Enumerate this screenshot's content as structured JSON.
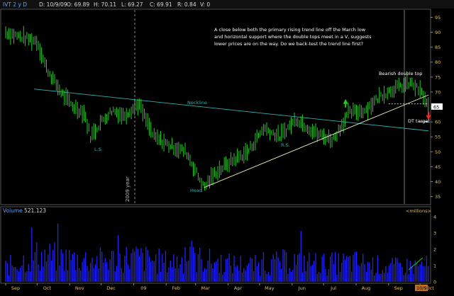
{
  "header": {
    "symbol": "IVT 2 y D",
    "date_label": "D: 10/9/09",
    "open_label": "O: 69.89",
    "high_label": "H: 70.11",
    "low_label": "L: 69.27",
    "close_label": "C: 69.91",
    "range_label": "R: 0.84",
    "v_label": "V: 0"
  },
  "annotations": {
    "commentary": [
      "A close below both the primary rising trend line off the March low",
      "and horizontal support where the double tops meet in a V, suggests",
      "lower prices are on the way. Do we back-test the trend line first?"
    ],
    "bearish_double_top": "Bearish double top",
    "neckline": "Neckline",
    "left_shoulder": "L.S.",
    "right_shoulder": "R.S.",
    "head": "Head",
    "dt_target": "DT target",
    "year_marker": "2009 year"
  },
  "volume_panel": {
    "title": "Volume",
    "value": "521.123",
    "units": "<millions>",
    "y_ticks": [
      "4",
      "3",
      "2",
      "1",
      "0"
    ]
  },
  "colors": {
    "background": "#000000",
    "price_bars": "#22cc22",
    "volume_bars": "#2222ff",
    "trendline": "#f0f0c0",
    "neckline": "#30b0b0",
    "support_line": "#ffffff",
    "up_arrow": "#22cc22",
    "down_arrow": "#ff2020",
    "axis_text": "#d8c060",
    "label_text": "#ffffff",
    "panel_label": "#5fa0ff",
    "frame": "#666666",
    "highlight_box": "#c07020"
  },
  "chart_data": {
    "type": "ohlc",
    "title": "IVT 2 y D",
    "y_ticks": [
      95,
      90,
      85,
      80,
      75,
      70,
      65,
      60,
      55,
      50,
      45,
      40,
      35
    ],
    "ylim": [
      33,
      97
    ],
    "last_price_tag": "65",
    "x_ticks": [
      "Sep",
      "Oct",
      "Nov",
      "Dec",
      "09",
      "Feb",
      "Mar",
      "Apr",
      "May",
      "Jun",
      "Jul",
      "Aug",
      "Sep",
      "Oct",
      "10/9"
    ],
    "price_path": [
      {
        "date": "2008-09-01",
        "price": 90
      },
      {
        "date": "2008-09-10",
        "price": 89
      },
      {
        "date": "2008-09-20",
        "price": 88
      },
      {
        "date": "2008-10-01",
        "price": 87
      },
      {
        "date": "2008-10-10",
        "price": 78
      },
      {
        "date": "2008-10-20",
        "price": 72
      },
      {
        "date": "2008-10-28",
        "price": 68
      },
      {
        "date": "2008-11-05",
        "price": 65
      },
      {
        "date": "2008-11-15",
        "price": 63
      },
      {
        "date": "2008-11-21",
        "price": 55
      },
      {
        "date": "2008-12-01",
        "price": 60
      },
      {
        "date": "2008-12-12",
        "price": 64
      },
      {
        "date": "2008-12-22",
        "price": 62
      },
      {
        "date": "2009-01-06",
        "price": 66
      },
      {
        "date": "2009-01-20",
        "price": 55
      },
      {
        "date": "2009-02-05",
        "price": 52
      },
      {
        "date": "2009-02-20",
        "price": 50
      },
      {
        "date": "2009-03-09",
        "price": 38
      },
      {
        "date": "2009-03-20",
        "price": 43
      },
      {
        "date": "2009-04-05",
        "price": 47
      },
      {
        "date": "2009-04-20",
        "price": 50
      },
      {
        "date": "2009-05-05",
        "price": 58
      },
      {
        "date": "2009-05-20",
        "price": 55
      },
      {
        "date": "2009-06-05",
        "price": 61
      },
      {
        "date": "2009-06-25",
        "price": 56
      },
      {
        "date": "2009-07-10",
        "price": 54
      },
      {
        "date": "2009-07-25",
        "price": 63
      },
      {
        "date": "2009-08-10",
        "price": 64
      },
      {
        "date": "2009-08-25",
        "price": 69
      },
      {
        "date": "2009-09-05",
        "price": 71
      },
      {
        "date": "2009-09-22",
        "price": 73
      },
      {
        "date": "2009-10-02",
        "price": 70
      },
      {
        "date": "2009-10-09",
        "price": 65
      }
    ],
    "neckline": [
      {
        "date": "2008-09-28",
        "price": 71
      },
      {
        "date": "2009-10-09",
        "price": 57
      }
    ],
    "trendline": [
      {
        "date": "2009-03-09",
        "price": 38
      },
      {
        "date": "2009-10-09",
        "price": 69
      }
    ],
    "support_level": {
      "price": 66,
      "from": "2009-09-01",
      "to": "2009-10-09"
    },
    "dt_target_price": 60,
    "up_arrow": {
      "date": "2009-07-22",
      "price": 66
    },
    "down_arrow": {
      "date": "2009-10-09",
      "price": 62
    },
    "volume": {
      "ylim": [
        0,
        4
      ],
      "series": [
        {
          "date": "2008-09-01",
          "value": 0.9
        },
        {
          "date": "2008-10-01",
          "value": 1.6
        },
        {
          "date": "2008-11-01",
          "value": 1.4
        },
        {
          "date": "2008-12-01",
          "value": 1.3
        },
        {
          "date": "2009-01-01",
          "value": 1.5
        },
        {
          "date": "2009-02-01",
          "value": 1.2
        },
        {
          "date": "2009-03-01",
          "value": 1.4
        },
        {
          "date": "2009-04-01",
          "value": 1.1
        },
        {
          "date": "2009-05-01",
          "value": 1.0
        },
        {
          "date": "2009-06-01",
          "value": 1.3
        },
        {
          "date": "2009-07-01",
          "value": 1.1
        },
        {
          "date": "2009-08-01",
          "value": 1.2
        },
        {
          "date": "2009-09-01",
          "value": 0.9
        },
        {
          "date": "2009-10-09",
          "value": 1.0
        }
      ]
    }
  }
}
